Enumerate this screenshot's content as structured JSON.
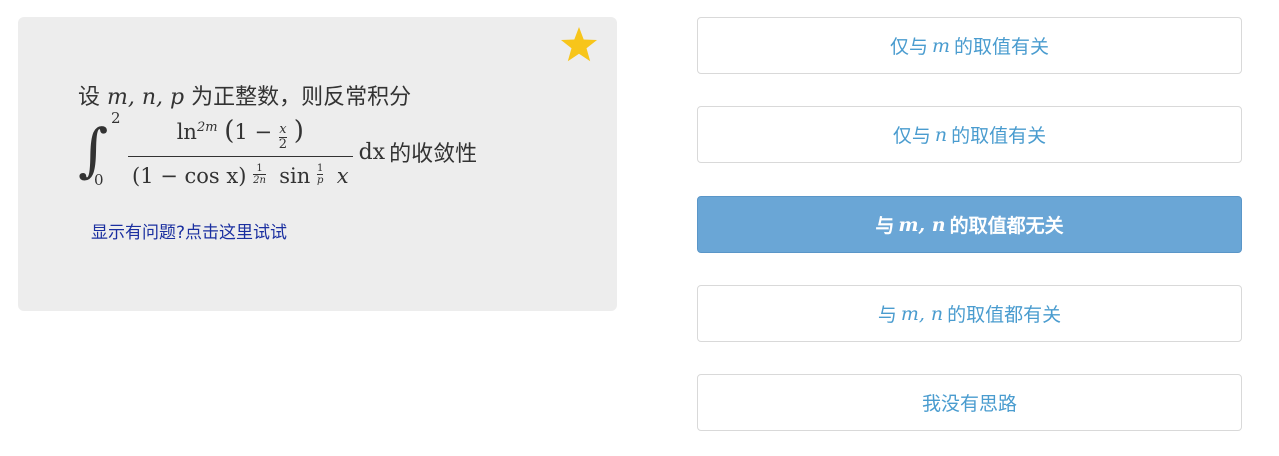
{
  "question": {
    "intro_prefix": "设",
    "intro_vars": "m, n, p",
    "intro_suffix": "为正整数，则反常积分",
    "integral_upper": "2",
    "integral_lower": "0",
    "numerator_ln": "ln",
    "numerator_exp": "2m",
    "numerator_paren_one": "1 −",
    "numerator_x": "x",
    "numerator_two": "2",
    "denominator_base": "(1 − cos x)",
    "denominator_exp1_num": "1",
    "denominator_exp1_den": "2n",
    "denominator_sin": "sin",
    "denominator_exp2_num": "1",
    "denominator_exp2_den": "p",
    "denominator_x": "x",
    "differential": "dx",
    "tail": "的收敛性",
    "help_link": "显示有问题?点击这里试试"
  },
  "colors": {
    "card_bg": "#ededed",
    "option_text": "#4a9ccf",
    "selected_bg": "#6aa6d6",
    "star": "#f7c51a",
    "link": "#1a2fa0"
  },
  "options": [
    {
      "prefix": "仅与",
      "vars": "m",
      "suffix": "的取值有关",
      "selected": false
    },
    {
      "prefix": "仅与",
      "vars": "n",
      "suffix": "的取值有关",
      "selected": false
    },
    {
      "prefix": "与",
      "vars": "m, n",
      "suffix": "的取值都无关",
      "selected": true
    },
    {
      "prefix": "与",
      "vars": "m, n",
      "suffix": "的取值都有关",
      "selected": false
    },
    {
      "prefix": "",
      "vars": "",
      "suffix": "我没有思路",
      "selected": false
    }
  ]
}
